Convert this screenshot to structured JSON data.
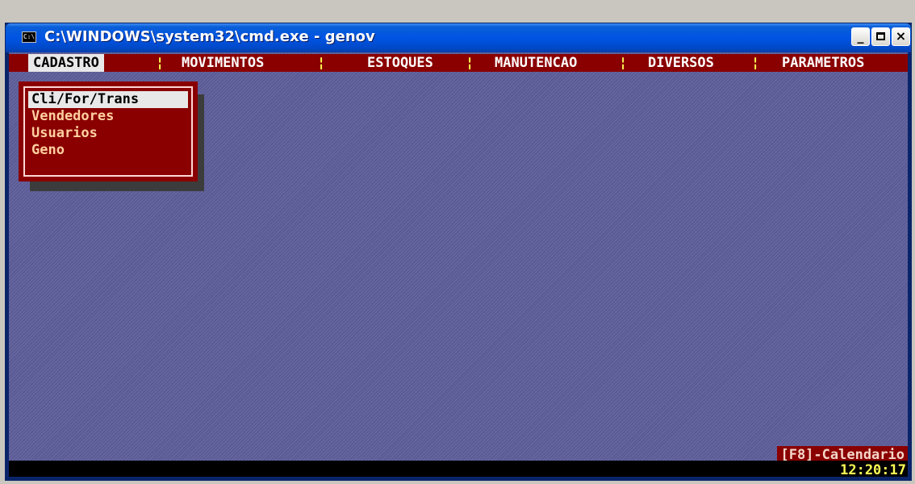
{
  "window": {
    "title": "C:\\WINDOWS\\system32\\cmd.exe - genov",
    "icon": "console-icon",
    "icon_label": "C:\\",
    "controls": {
      "minimize": "_",
      "close": "×"
    }
  },
  "menu": {
    "separator": "¦",
    "items": [
      {
        "label": "CADASTRO",
        "active": true
      },
      {
        "label": "MOVIMENTOS"
      },
      {
        "label": "ESTOQUES"
      },
      {
        "label": "MANUTENCAO"
      },
      {
        "label": "DIVERSOS"
      },
      {
        "label": "PARAMETROS"
      }
    ]
  },
  "dropdown": {
    "items": [
      {
        "label": "Cli/For/Trans",
        "selected": true
      },
      {
        "label": "Vendedores"
      },
      {
        "label": "Usuarios"
      },
      {
        "label": "Geno"
      }
    ]
  },
  "hint": "[F8]-Calendario",
  "clock": "12:20:17",
  "colors": {
    "console_bg": "#5a5a96",
    "menu_bg": "#8a0000",
    "highlight": "#e8e8e8",
    "clock_text": "#ffff55"
  }
}
